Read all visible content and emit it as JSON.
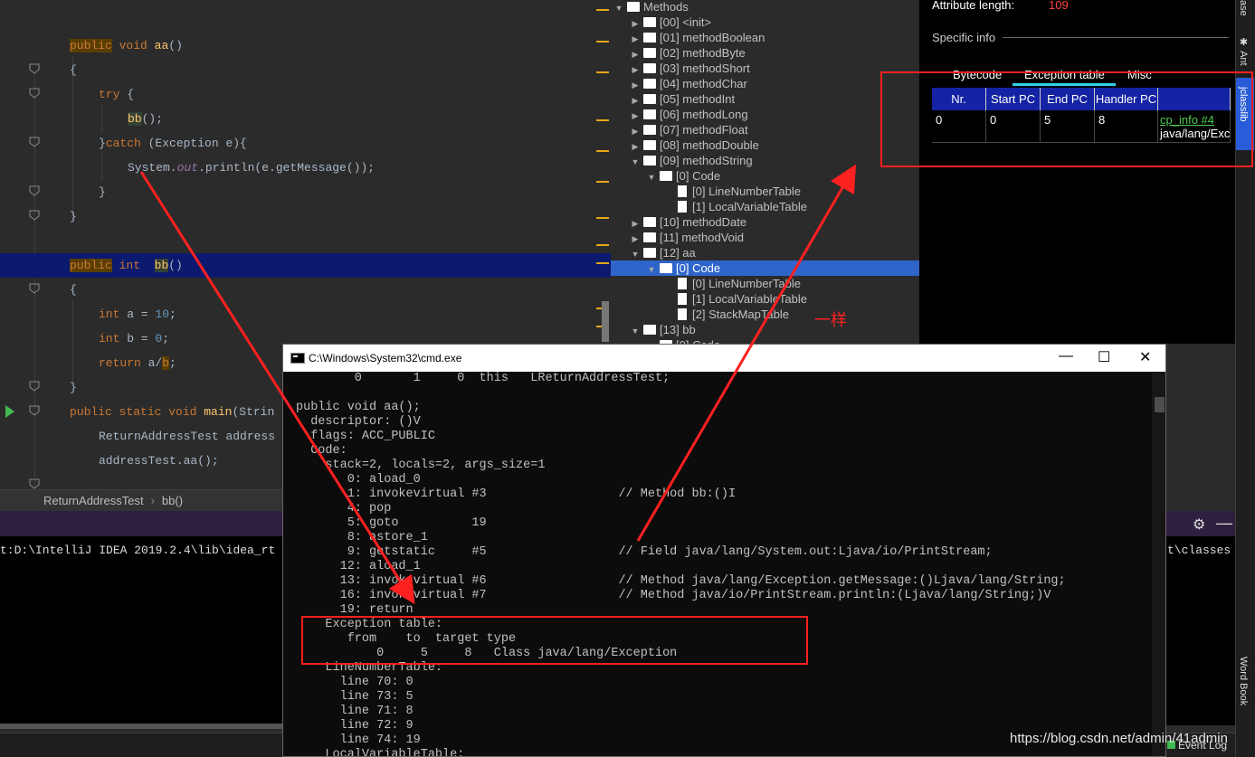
{
  "editor": {
    "lines": [
      {
        "segments": [
          [
            "kw-bg",
            "public"
          ],
          [
            "",
            " "
          ],
          [
            "kw",
            "void"
          ],
          [
            "",
            " "
          ],
          [
            "fn",
            "aa"
          ],
          [
            "",
            "()"
          ]
        ]
      },
      {
        "segments": [
          [
            "",
            "{"
          ]
        ]
      },
      {
        "segments": [
          [
            "kw",
            "try"
          ],
          [
            "",
            " {"
          ]
        ]
      },
      {
        "segments": [
          [
            "fn-bg",
            "bb"
          ],
          [
            "",
            "();"
          ]
        ]
      },
      {
        "segments": [
          [
            "",
            "}"
          ],
          [
            "kw",
            "catch"
          ],
          [
            "",
            " (Exception e){"
          ]
        ]
      },
      {
        "segments": [
          [
            "",
            "System."
          ],
          [
            "fld",
            "out"
          ],
          [
            "",
            ".println(e.getMessage());"
          ]
        ]
      },
      {
        "segments": [
          [
            "",
            "}"
          ]
        ]
      },
      {
        "segments": [
          [
            "",
            "}"
          ]
        ]
      },
      {
        "segments": [
          [
            "kw-bg",
            "public"
          ],
          [
            "",
            " "
          ],
          [
            "kw",
            "int"
          ],
          [
            "",
            "  "
          ],
          [
            "fn-bg",
            "bb"
          ],
          [
            "",
            "()"
          ]
        ]
      },
      {
        "segments": [
          [
            "",
            "{"
          ]
        ]
      },
      {
        "segments": [
          [
            "kw",
            "int"
          ],
          [
            "",
            " a = "
          ],
          [
            "num",
            "10"
          ],
          [
            "",
            ";"
          ]
        ]
      },
      {
        "segments": [
          [
            "kw",
            "int"
          ],
          [
            "",
            " b = "
          ],
          [
            "num",
            "0"
          ],
          [
            "",
            ";"
          ]
        ]
      },
      {
        "segments": [
          [
            "kw",
            "return"
          ],
          [
            "",
            " a/"
          ],
          [
            "kw-bg",
            "b"
          ],
          [
            "",
            ";"
          ]
        ]
      },
      {
        "segments": [
          [
            "",
            "}"
          ]
        ]
      },
      {
        "segments": [
          [
            "kw",
            "public static void"
          ],
          [
            "",
            " "
          ],
          [
            "fn",
            "main"
          ],
          [
            "",
            "(Strin"
          ]
        ]
      },
      {
        "segments": [
          [
            "",
            "ReturnAddressTest address"
          ]
        ]
      },
      {
        "segments": [
          [
            "",
            "addressTest.aa();"
          ]
        ]
      }
    ],
    "breadcrumb": [
      "ReturnAddressTest",
      "bb()"
    ]
  },
  "run": {
    "cmdline": "t:D:\\IntelliJ IDEA 2019.2.4\\lib\\idea_rt",
    "cmdline_right": "t\\classes",
    "event_log": "Event Log"
  },
  "tree": {
    "rows": [
      {
        "indent": 0,
        "tri": "▼",
        "icon": "folder",
        "label": "Methods"
      },
      {
        "indent": 1,
        "tri": "▶",
        "icon": "folder",
        "label": "[00] <init>"
      },
      {
        "indent": 1,
        "tri": "▶",
        "icon": "folder",
        "label": "[01] methodBoolean"
      },
      {
        "indent": 1,
        "tri": "▶",
        "icon": "folder",
        "label": "[02] methodByte"
      },
      {
        "indent": 1,
        "tri": "▶",
        "icon": "folder",
        "label": "[03] methodShort"
      },
      {
        "indent": 1,
        "tri": "▶",
        "icon": "folder",
        "label": "[04] methodChar"
      },
      {
        "indent": 1,
        "tri": "▶",
        "icon": "folder",
        "label": "[05] methodInt"
      },
      {
        "indent": 1,
        "tri": "▶",
        "icon": "folder",
        "label": "[06] methodLong"
      },
      {
        "indent": 1,
        "tri": "▶",
        "icon": "folder",
        "label": "[07] methodFloat"
      },
      {
        "indent": 1,
        "tri": "▶",
        "icon": "folder",
        "label": "[08] methodDouble"
      },
      {
        "indent": 1,
        "tri": "▼",
        "icon": "folder",
        "label": "[09] methodString"
      },
      {
        "indent": 2,
        "tri": "▼",
        "icon": "folder",
        "label": "[0] Code"
      },
      {
        "indent": 3,
        "tri": "",
        "icon": "file",
        "label": "[0] LineNumberTable"
      },
      {
        "indent": 3,
        "tri": "",
        "icon": "file",
        "label": "[1] LocalVariableTable"
      },
      {
        "indent": 1,
        "tri": "▶",
        "icon": "folder",
        "label": "[10] methodDate"
      },
      {
        "indent": 1,
        "tri": "▶",
        "icon": "folder",
        "label": "[11] methodVoid"
      },
      {
        "indent": 1,
        "tri": "▼",
        "icon": "folder",
        "label": "[12] aa"
      },
      {
        "indent": 2,
        "tri": "▼",
        "icon": "folder",
        "label": "[0] Code",
        "selected": true
      },
      {
        "indent": 3,
        "tri": "",
        "icon": "file",
        "label": "[0] LineNumberTable"
      },
      {
        "indent": 3,
        "tri": "",
        "icon": "file",
        "label": "[1] LocalVariableTable"
      },
      {
        "indent": 3,
        "tri": "",
        "icon": "file",
        "label": "[2] StackMapTable"
      },
      {
        "indent": 1,
        "tri": "▼",
        "icon": "folder",
        "label": "[13] bb"
      },
      {
        "indent": 2,
        "tri": "▼",
        "icon": "folder",
        "label": "[0] Code"
      }
    ]
  },
  "detail": {
    "attr_len_label": "Attribute length:",
    "attr_len_value": "109",
    "specific_info": "Specific info",
    "tabs": [
      "Bytecode",
      "Exception table",
      "Misc"
    ],
    "table_headers": [
      "Nr.",
      "Start PC",
      "End PC",
      "Handler PC",
      ""
    ],
    "row": {
      "nr": "0",
      "start": "0",
      "end": "5",
      "handler": "8",
      "link": "cp_info #4",
      "link_sub": "java/lang/Exc"
    }
  },
  "strip": {
    "top_label": "ase",
    "ant": "Ant",
    "jclasslib": "jclasslib",
    "word_book": "Word Book"
  },
  "cmd": {
    "title": "C:\\Windows\\System32\\cmd.exe",
    "min": "—",
    "max": "☐",
    "close": "✕",
    "lines": [
      "        0       1     0  this   LReturnAddressTest;",
      "",
      "public void aa();",
      "  descriptor: ()V",
      "  flags: ACC_PUBLIC",
      "  Code:",
      "    stack=2, locals=2, args_size=1",
      "       0: aload_0",
      "       1: invokevirtual #3                  // Method bb:()I",
      "       4: pop",
      "       5: goto          19",
      "       8: astore_1",
      "       9: getstatic     #5                  // Field java/lang/System.out:Ljava/io/PrintStream;",
      "      12: aload_1",
      "      13: invokevirtual #6                  // Method java/lang/Exception.getMessage:()Ljava/lang/String;",
      "      16: invokevirtual #7                  // Method java/io/PrintStream.println:(Ljava/lang/String;)V",
      "      19: return",
      "    Exception table:",
      "       from    to  target type",
      "           0     5     8   Class java/lang/Exception",
      "    LineNumberTable:",
      "      line 70: 0",
      "      line 73: 5",
      "      line 71: 8",
      "      line 72: 9",
      "      line 74: 19",
      "    LocalVariableTable:"
    ]
  },
  "annotation": {
    "text": "一样"
  },
  "watermark": "https://blog.csdn.net/admin/41admin"
}
